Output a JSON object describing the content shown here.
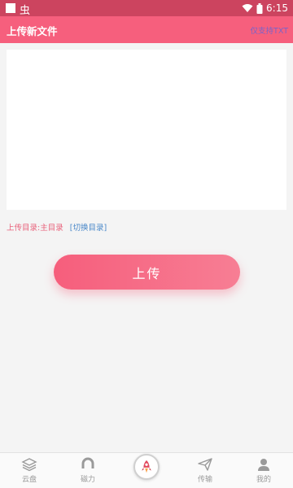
{
  "status_bar": {
    "time": "6:15",
    "bug_glyph": "虫"
  },
  "app_bar": {
    "title": "上传新文件",
    "action": "仅支持TXT"
  },
  "editor": {
    "value": "",
    "placeholder": ""
  },
  "directory": {
    "label": "上传目录:主目录",
    "switch": "[切换目录]"
  },
  "upload_button": "上传",
  "nav": {
    "items": [
      {
        "label": "云盘",
        "icon": "layers-icon"
      },
      {
        "label": "磁力",
        "icon": "magnet-icon"
      },
      {
        "label": "",
        "icon": "rocket-icon"
      },
      {
        "label": "传输",
        "icon": "paper-plane-icon"
      },
      {
        "label": "我的",
        "icon": "user-icon"
      }
    ]
  },
  "colors": {
    "primary": "#f65f7d",
    "status": "#cc445f",
    "link": "#4a88c9",
    "action": "#7a63c9"
  }
}
